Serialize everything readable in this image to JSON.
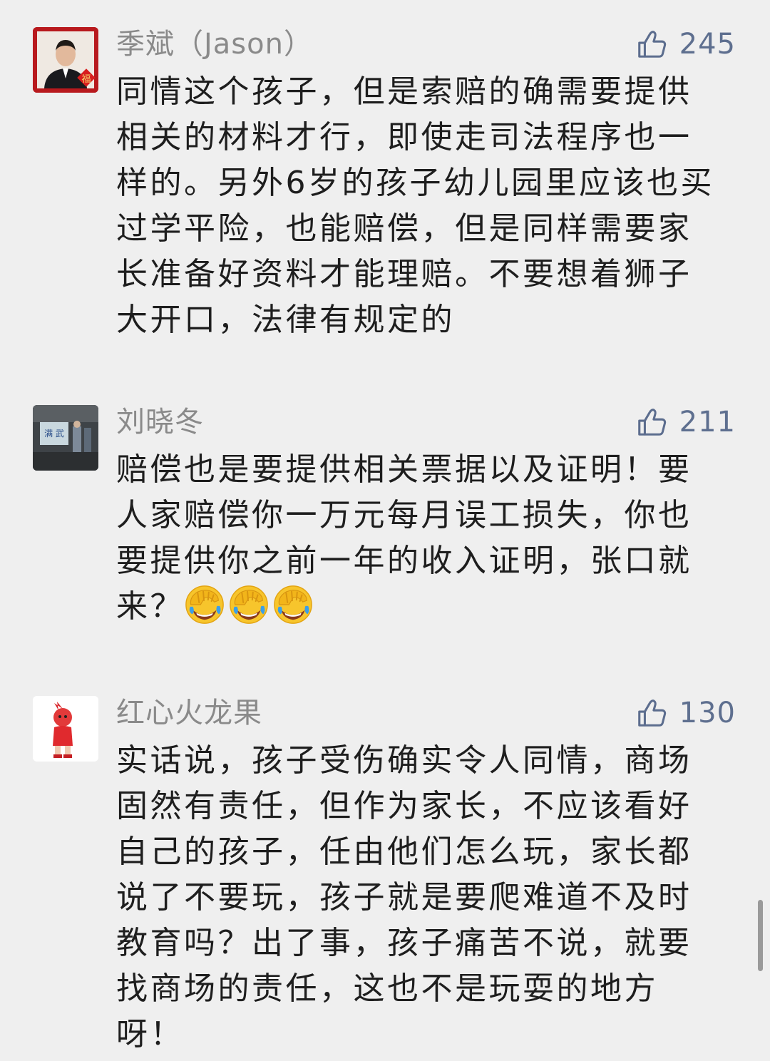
{
  "comments": [
    {
      "user": "季斌（Jason）",
      "likes": "245",
      "lines": [
        "同情这个孩子，但是索赔的确需要提供",
        "相关的材料才行，即使走司法程序也一",
        "样的。另外6岁的孩子幼儿园里应该也买",
        "过学平险，也能赔偿，但是同样需要家",
        "长准备好资料才能理赔。不要想着狮子",
        "大开口，法律有规定的"
      ]
    },
    {
      "user": "刘晓冬",
      "likes": "211",
      "lines": [
        "赔偿也是要提供相关票据以及证明！要",
        "人家赔偿你一万元每月误工损失，你也",
        "要提供你之前一年的收入证明，张口就",
        "来？"
      ],
      "emojis": [
        "facepalm-cry-emoji",
        "facepalm-cry-emoji",
        "facepalm-cry-emoji"
      ]
    },
    {
      "user": "红心火龙果",
      "likes": "130",
      "lines": [
        "实话说，孩子受伤确实令人同情，商场",
        "固然有责任，但作为家长，不应该看好",
        "自己的孩子，任由他们怎么玩，家长都",
        "说了不要玩，孩子就是要爬难道不及时",
        "教育吗？出了事，孩子痛苦不说，就要",
        "找商场的责任，这也不是玩耍的地方",
        "呀！"
      ]
    }
  ],
  "colors": {
    "background": "#efefef",
    "username": "#8a8a8a",
    "like": "#5e6f8f",
    "text": "#1e1e1e"
  },
  "icons": {
    "like": "thumbs-up-icon"
  }
}
